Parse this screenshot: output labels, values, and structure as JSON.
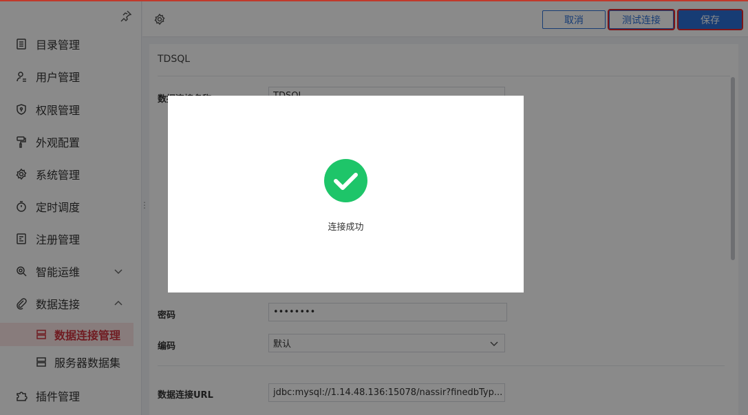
{
  "sidebar": {
    "items": [
      {
        "label": "目录管理",
        "icon": "list-icon"
      },
      {
        "label": "用户管理",
        "icon": "user-icon"
      },
      {
        "label": "权限管理",
        "icon": "shield-icon"
      },
      {
        "label": "外观配置",
        "icon": "paint-roller-icon"
      },
      {
        "label": "系统管理",
        "icon": "gear-icon"
      },
      {
        "label": "定时调度",
        "icon": "timer-icon"
      },
      {
        "label": "注册管理",
        "icon": "register-icon"
      },
      {
        "label": "智能运维",
        "icon": "ops-icon"
      },
      {
        "label": "数据连接",
        "icon": "paperclip-icon"
      },
      {
        "label": "插件管理",
        "icon": "puzzle-icon"
      }
    ],
    "sub_items": [
      {
        "label": "数据连接管理",
        "icon": "server-icon"
      },
      {
        "label": "服务器数据集",
        "icon": "server-icon"
      }
    ]
  },
  "toolbar": {
    "cancel_label": "取消",
    "test_label": "测试连接",
    "save_label": "保存"
  },
  "panel": {
    "title": "TDSQL",
    "fields": {
      "name_label": "数据连接名称",
      "name_value": "TDSQL",
      "password_label": "密码",
      "password_value": "••••••••",
      "encoding_label": "编码",
      "encoding_value": "默认",
      "url_label": "数据连接URL",
      "url_value": "jdbc:mysql://1.14.48.136:15078/nassir?finedbTyp..."
    }
  },
  "dialog": {
    "message": "连接成功"
  },
  "colors": {
    "accent": "#2b6fd6",
    "active_red": "#d0353f",
    "success_green": "#1ec569",
    "highlight_red": "#e8252a"
  }
}
